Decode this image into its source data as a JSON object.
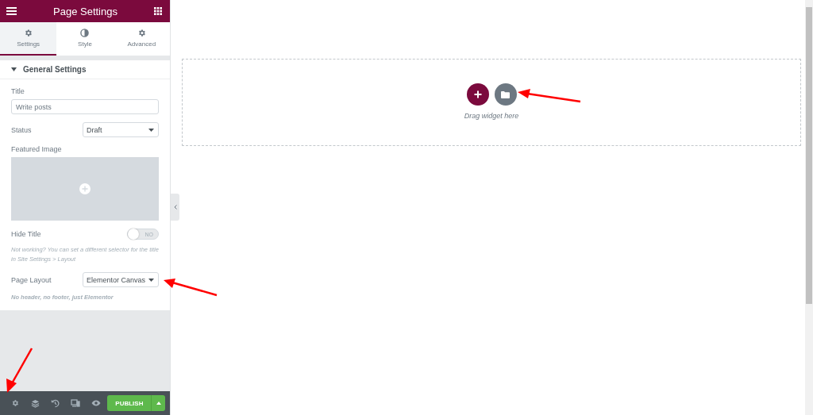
{
  "panel": {
    "title": "Page Settings",
    "tabs": [
      {
        "label": "Settings",
        "selected": true
      },
      {
        "label": "Style",
        "selected": false
      },
      {
        "label": "Advanced",
        "selected": false
      }
    ],
    "section": {
      "title": "General Settings",
      "expanded": true,
      "controls": [
        {
          "kind": "text",
          "label": "Title",
          "value": "Write posts"
        },
        {
          "kind": "select",
          "label": "Status",
          "value": "Draft"
        },
        {
          "kind": "image",
          "label": "Featured Image"
        },
        {
          "kind": "switch",
          "label": "Hide Title",
          "on": false,
          "off_text": "NO"
        },
        {
          "kind": "note",
          "text": "Not working? You can set a different selector for the title in Site Settings > Layout"
        },
        {
          "kind": "select",
          "label": "Page Layout",
          "value": "Elementor Canvas"
        },
        {
          "kind": "hint",
          "text": "No header, no footer, just Elementor"
        }
      ]
    },
    "footer": {
      "publish": "PUBLISH"
    }
  },
  "canvas": {
    "drop_text": "Drag widget here"
  }
}
